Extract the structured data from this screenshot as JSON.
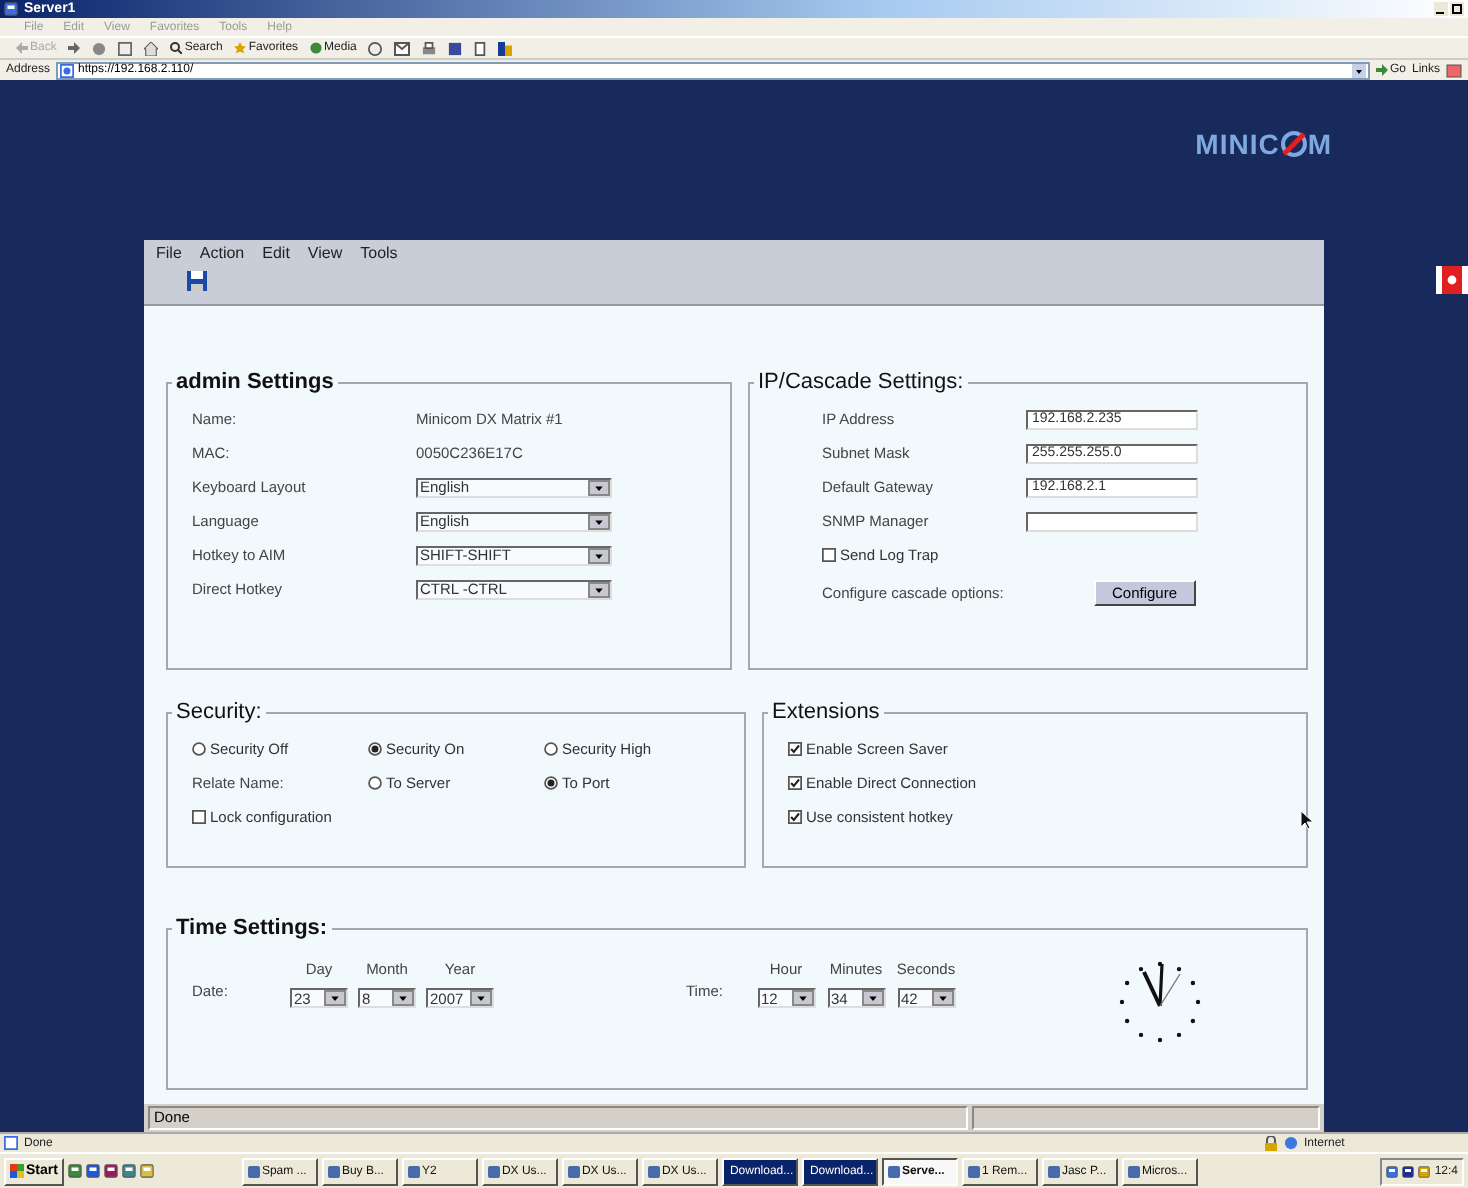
{
  "browser": {
    "title": "Server1",
    "menu": [
      "File",
      "Edit",
      "View",
      "Favorites",
      "Tools",
      "Help"
    ],
    "back": "Back",
    "search": "Search",
    "favorites": "Favorites",
    "media": "Media",
    "address_label": "Address",
    "address": "https://192.168.2.110/",
    "go": "Go",
    "links": "Links"
  },
  "logo": {
    "before": "MINIC",
    "after": "M"
  },
  "app": {
    "menu": [
      "File",
      "Action",
      "Edit",
      "View",
      "Tools"
    ],
    "admin": {
      "title": "admin Settings",
      "rows": [
        {
          "kind": "text",
          "label": "Name:",
          "value": "Minicom DX Matrix #1"
        },
        {
          "kind": "text",
          "label": "MAC:",
          "value": "0050C236E17C"
        },
        {
          "kind": "select",
          "label": "Keyboard Layout",
          "value": "English"
        },
        {
          "kind": "select",
          "label": "Language",
          "value": "English"
        },
        {
          "kind": "select",
          "label": "Hotkey to AIM",
          "value": "SHIFT-SHIFT"
        },
        {
          "kind": "select",
          "label": "Direct Hotkey",
          "value": "CTRL -CTRL"
        }
      ]
    },
    "network": {
      "title": "IP/Cascade Settings:",
      "fields": [
        {
          "label": "IP Address",
          "value": "192.168.2.235"
        },
        {
          "label": "Subnet Mask",
          "value": "255.255.255.0"
        },
        {
          "label": "Default Gateway",
          "value": "192.168.2.1"
        },
        {
          "label": "SNMP Manager"
        }
      ],
      "log_trap": {
        "label": "Send Log Trap",
        "checked": false
      },
      "cascade_label": "Configure cascade options:",
      "configure": "Configure"
    },
    "security": {
      "title": "Security:",
      "levels": [
        {
          "label": "Security Off",
          "selected": false
        },
        {
          "label": "Security On",
          "selected": true
        },
        {
          "label": "Security High",
          "selected": false
        }
      ],
      "relate_label": "Relate Name:",
      "relate": [
        {
          "label": "To Server",
          "selected": false
        },
        {
          "label": "To Port",
          "selected": true
        }
      ],
      "lock": {
        "label": "Lock configuration",
        "checked": false
      }
    },
    "extensions": {
      "title": "Extensions",
      "items": [
        {
          "label": "Enable Screen Saver",
          "checked": true
        },
        {
          "label": "Enable Direct Connection",
          "checked": true
        },
        {
          "label": "Use consistent hotkey",
          "checked": true
        }
      ]
    },
    "time": {
      "title": "Time Settings:",
      "date_label": "Date:",
      "date": [
        {
          "label": "Day",
          "value": "23"
        },
        {
          "label": "Month",
          "value": "8"
        },
        {
          "label": "Year",
          "value": "2007"
        }
      ],
      "time_label": "Time:",
      "clock": [
        {
          "label": "Hour",
          "value": "12"
        },
        {
          "label": "Minutes",
          "value": "34"
        },
        {
          "label": "Seconds",
          "value": "42"
        }
      ]
    },
    "status": "Done"
  },
  "ie_status": {
    "text": "Done",
    "zone": "Internet"
  },
  "taskbar": {
    "start": "Start",
    "tasks": [
      {
        "label": "Spam ...",
        "selected": false,
        "highlighted": false
      },
      {
        "label": "Buy B...",
        "selected": false,
        "highlighted": false
      },
      {
        "label": "Y2",
        "selected": false,
        "highlighted": false
      },
      {
        "label": "DX Us...",
        "selected": false,
        "highlighted": false
      },
      {
        "label": "DX Us...",
        "selected": false,
        "highlighted": false
      },
      {
        "label": "DX Us...",
        "selected": false,
        "highlighted": false
      },
      {
        "label": "Download...",
        "selected": false,
        "highlighted": true
      },
      {
        "label": "Download...",
        "selected": false,
        "highlighted": true
      },
      {
        "label": "Serve...",
        "selected": true,
        "highlighted": false
      },
      {
        "label": "1 Rem...",
        "selected": false,
        "highlighted": false
      },
      {
        "label": "Jasc P...",
        "selected": false,
        "highlighted": false
      },
      {
        "label": "Micros...",
        "selected": false,
        "highlighted": false
      }
    ],
    "clock": "12:4"
  }
}
